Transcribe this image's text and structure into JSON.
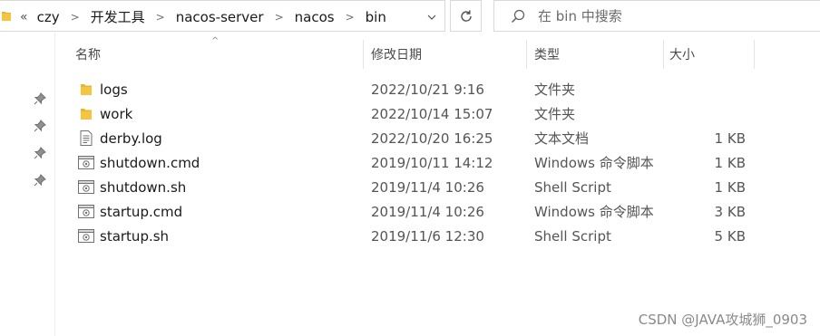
{
  "address_bar": {
    "breadcrumbs": [
      "czy",
      "开发工具",
      "nacos-server",
      "nacos",
      "bin"
    ]
  },
  "search": {
    "placeholder": "在 bin 中搜索"
  },
  "columns": {
    "name": "名称",
    "date": "修改日期",
    "type": "类型",
    "size": "大小"
  },
  "files": [
    {
      "icon": "folder-icon",
      "name": "logs",
      "date": "2022/10/21 9:16",
      "type": "文件夹",
      "size": ""
    },
    {
      "icon": "folder-icon",
      "name": "work",
      "date": "2022/10/14 15:07",
      "type": "文件夹",
      "size": ""
    },
    {
      "icon": "text-file-icon",
      "name": "derby.log",
      "date": "2022/10/20 16:25",
      "type": "文本文档",
      "size": "1 KB"
    },
    {
      "icon": "script-file-icon",
      "name": "shutdown.cmd",
      "date": "2019/10/11 14:12",
      "type": "Windows 命令脚本",
      "size": "1 KB"
    },
    {
      "icon": "script-file-icon",
      "name": "shutdown.sh",
      "date": "2019/11/4 10:26",
      "type": "Shell Script",
      "size": "1 KB"
    },
    {
      "icon": "script-file-icon",
      "name": "startup.cmd",
      "date": "2019/11/4 10:26",
      "type": "Windows 命令脚本",
      "size": "3 KB"
    },
    {
      "icon": "script-file-icon",
      "name": "startup.sh",
      "date": "2019/11/6 12:30",
      "type": "Shell Script",
      "size": "5 KB"
    }
  ],
  "watermark": "CSDN @JAVA攻城狮_0903",
  "colors": {
    "folder": "#f5c542",
    "border": "#d9d9d9"
  }
}
